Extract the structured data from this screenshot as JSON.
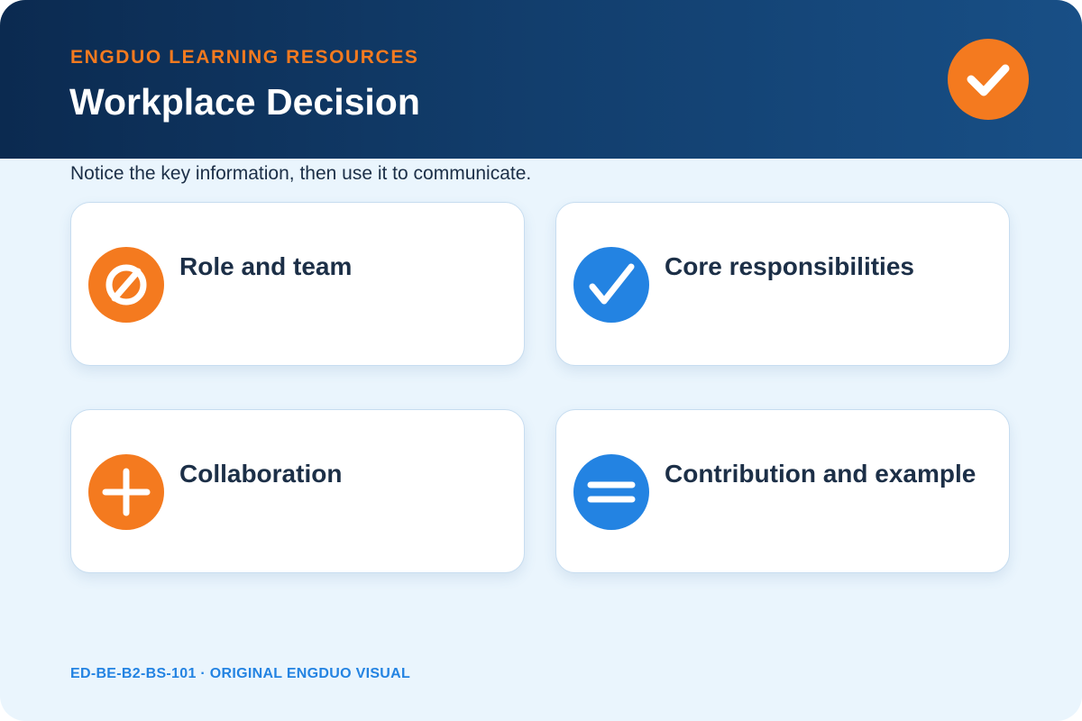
{
  "header": {
    "eyebrow": "ENGDUO LEARNING RESOURCES",
    "title": "Workplace Decision",
    "badge_icon": "checkmark-icon"
  },
  "subtitle": "Notice the key information, then use it to communicate.",
  "tiles": [
    {
      "label": "Role and team",
      "icon": "slashed-circle-icon",
      "icon_color": "#f47a1f"
    },
    {
      "label": "Core responsibilities",
      "icon": "checkmark-icon",
      "icon_color": "#2383e2"
    },
    {
      "label": "Collaboration",
      "icon": "plus-icon",
      "icon_color": "#f47a1f"
    },
    {
      "label": "Contribution and example",
      "icon": "equals-icon",
      "icon_color": "#2383e2"
    }
  ],
  "footer": "ED-BE-B2-BS-101 · ORIGINAL ENGDUO VISUAL",
  "colors": {
    "header_start": "#0b2a50",
    "header_end": "#184f86",
    "accent_orange": "#f47a1f",
    "accent_blue": "#2383e2",
    "background": "#eaf5fd",
    "text_dark": "#1c2f47"
  }
}
